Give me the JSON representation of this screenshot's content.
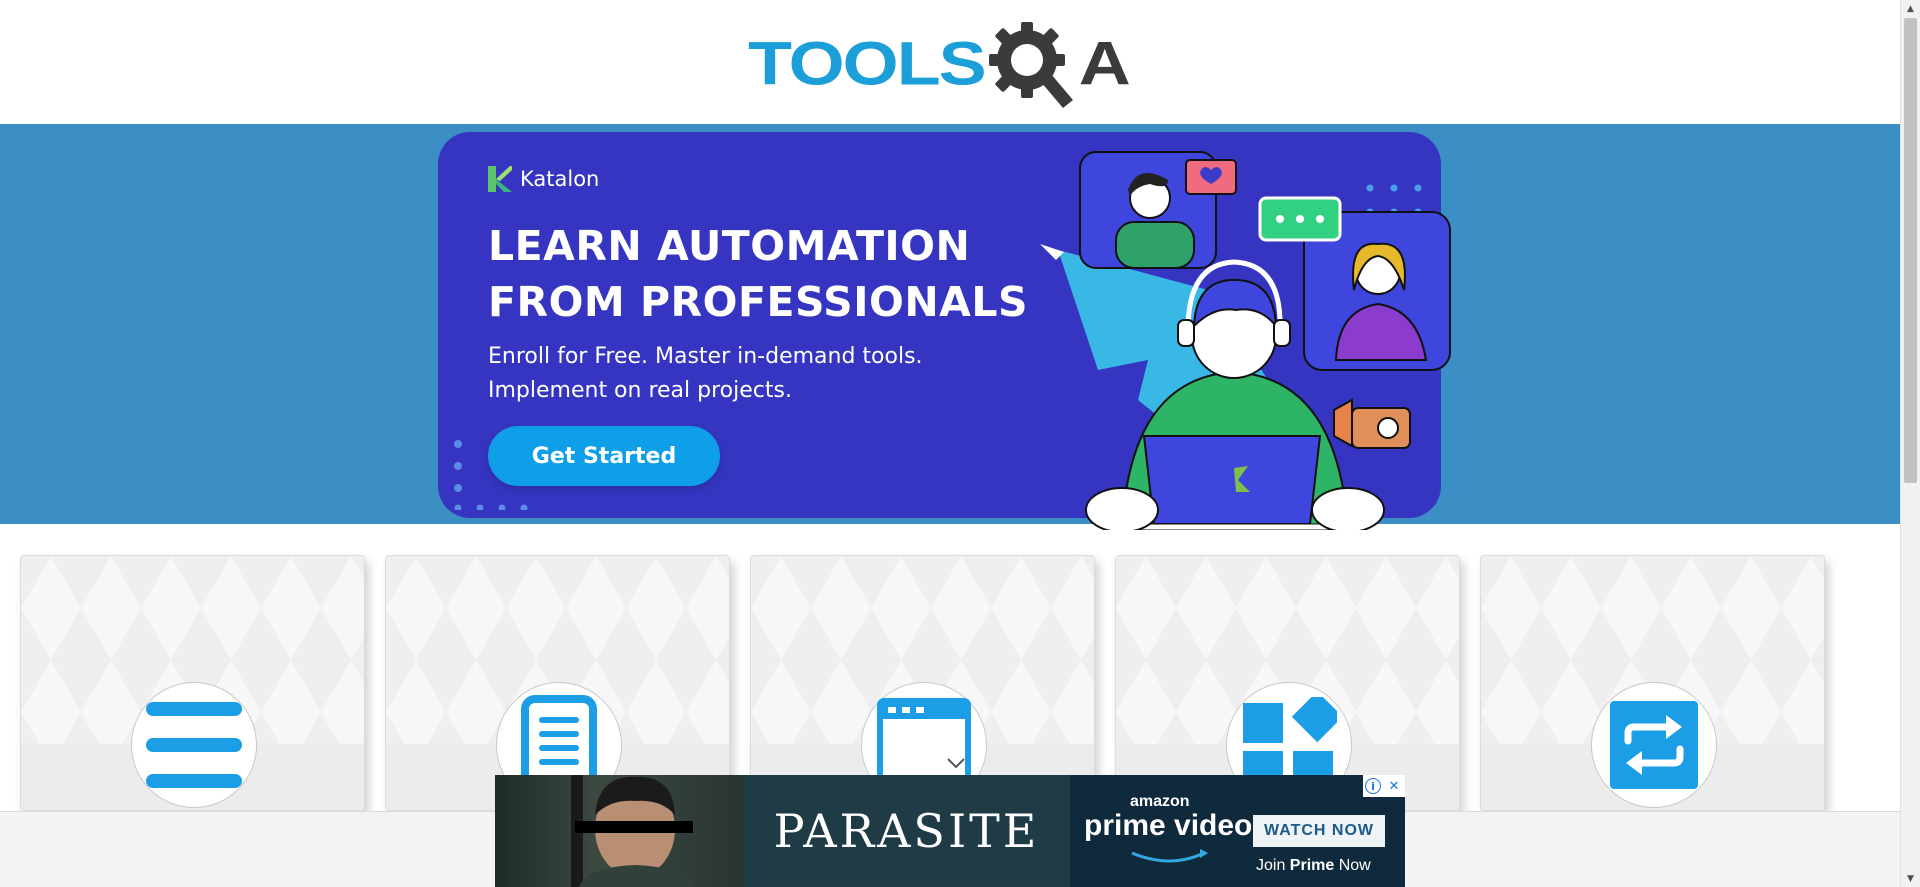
{
  "header": {
    "logo_tools": "TOOLS",
    "logo_a": "A"
  },
  "banner": {
    "brand": "Katalon",
    "headline_line1": "LEARN AUTOMATION",
    "headline_line2": "FROM PROFESSIONALS",
    "sub_line1": "Enroll for Free. Master in-demand tools.",
    "sub_line2": "Implement on real projects.",
    "cta_label": "Get Started",
    "colors": {
      "banner_bg": "#3535c2",
      "band_bg": "#3b8fc5",
      "cta_bg": "#0f9fe8"
    }
  },
  "cards": [
    {
      "icon": "hamburger-menu-icon"
    },
    {
      "icon": "document-list-icon"
    },
    {
      "icon": "browser-window-icon"
    },
    {
      "icon": "widgets-blocks-icon"
    },
    {
      "icon": "interactions-arrows-icon"
    }
  ],
  "ad": {
    "title": "PARASITE",
    "amazon": "amazon",
    "prime_video": "prime video",
    "watch_now": "WATCH NOW",
    "join_prefix": "Join ",
    "join_bold": "Prime",
    "join_suffix": " Now",
    "info_icon": "i",
    "close_icon": "✕"
  },
  "scrollbar": {
    "up_arrow": "▲",
    "down_arrow": "▼"
  },
  "accent_color": "#1c9ed8"
}
